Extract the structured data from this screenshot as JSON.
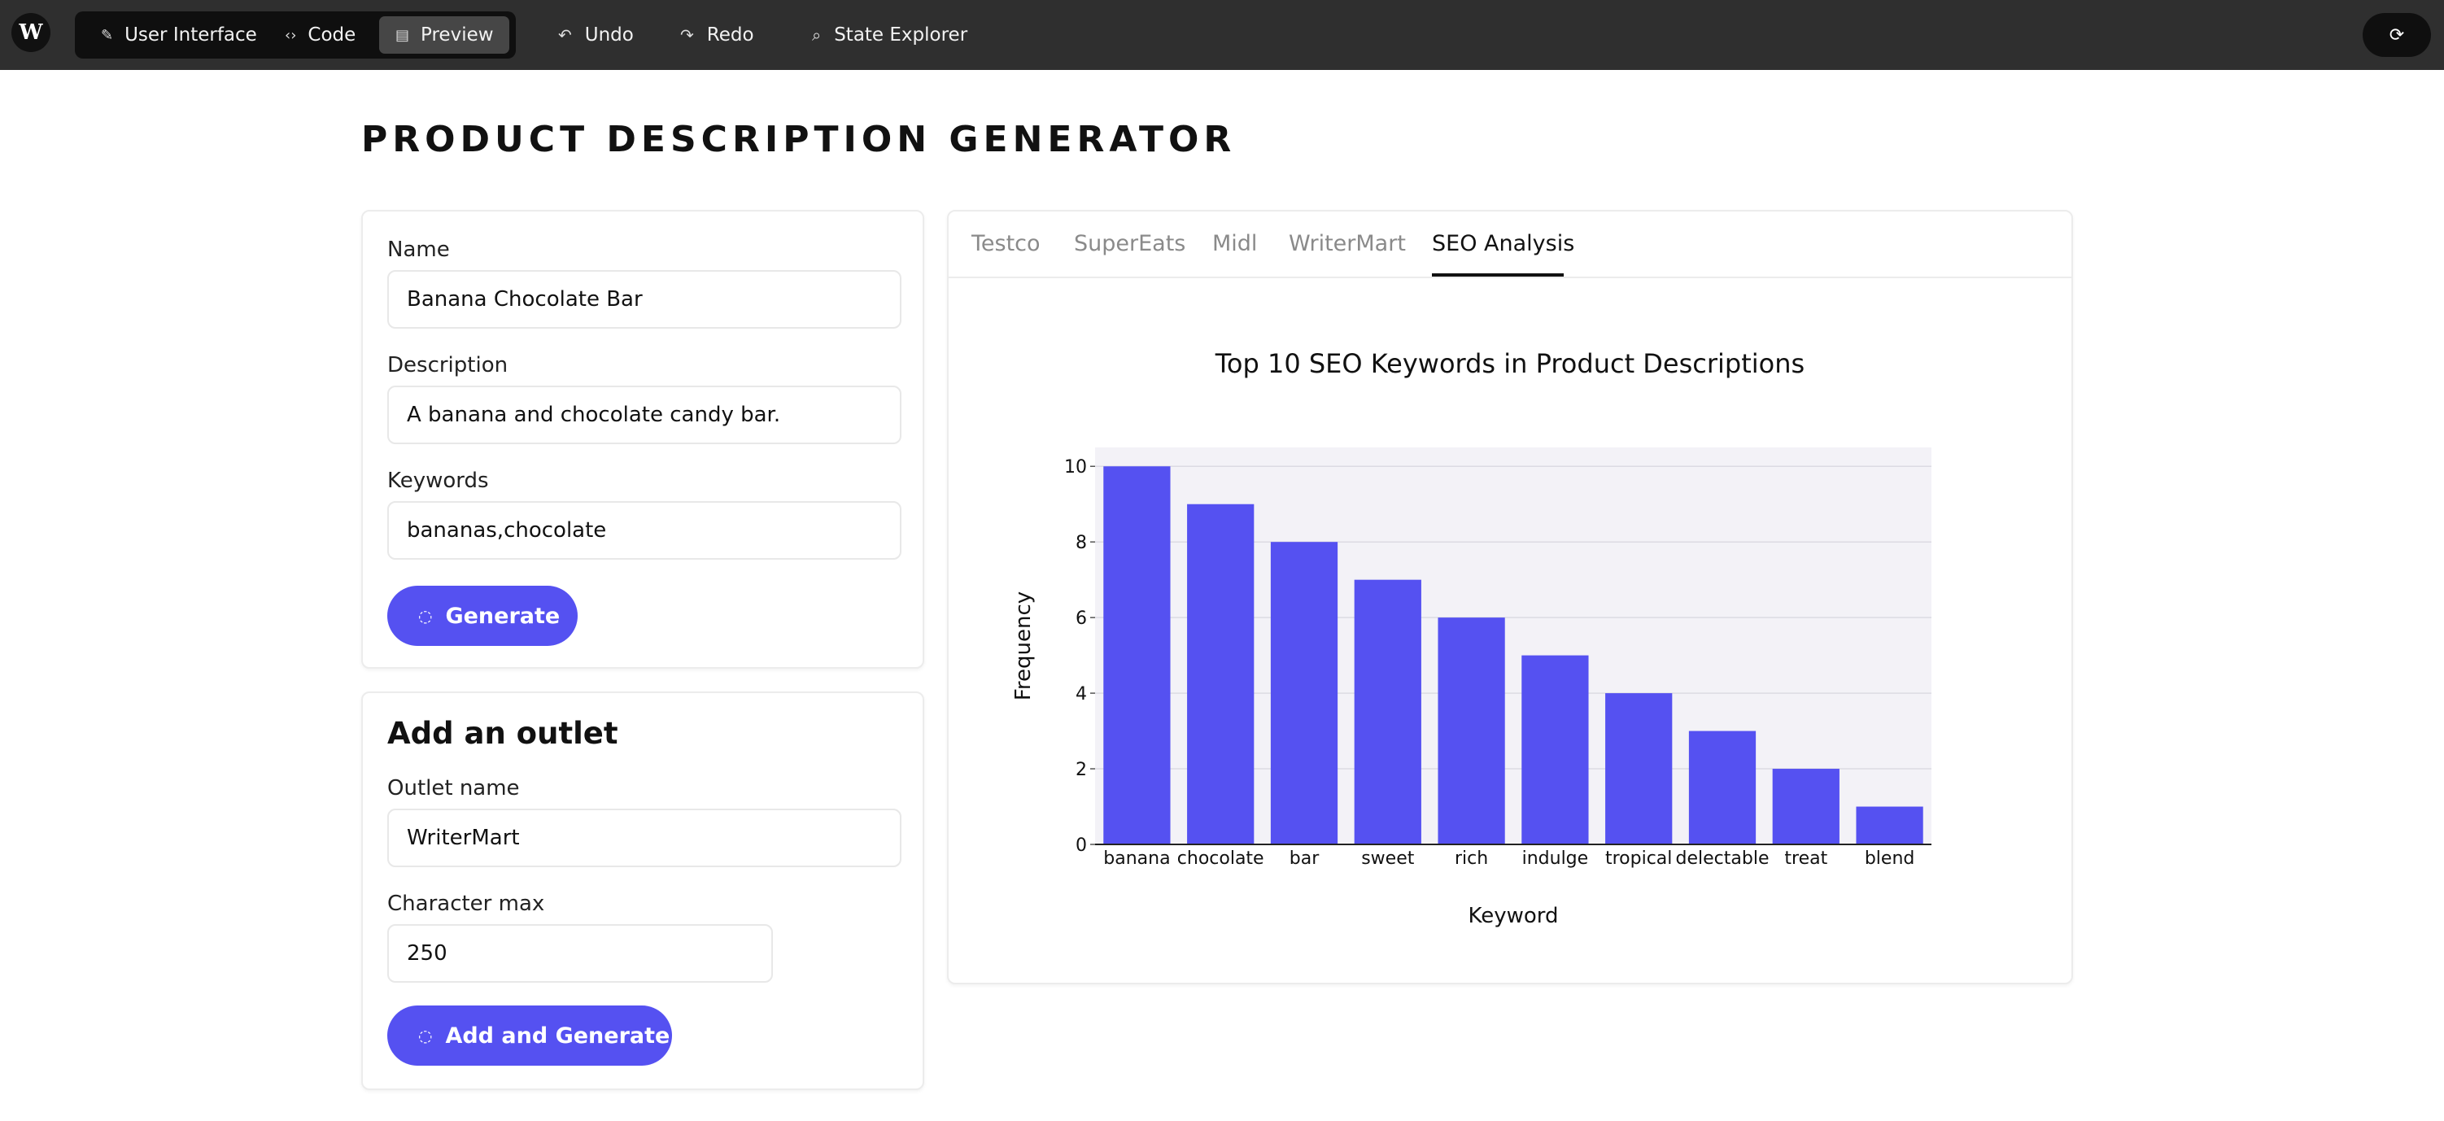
{
  "topbar": {
    "logo_text": "W",
    "modes": [
      {
        "label": "User Interface",
        "icon": "pencil-icon",
        "active": false
      },
      {
        "label": "Code",
        "icon": "code-icon",
        "active": false
      },
      {
        "label": "Preview",
        "icon": "preview-icon",
        "active": true
      }
    ],
    "undo_label": "Undo",
    "redo_label": "Redo",
    "state_explorer_label": "State Explorer",
    "refresh_icon": "refresh-icon"
  },
  "page": {
    "title": "PRODUCT DESCRIPTION GENERATOR"
  },
  "form": {
    "name_label": "Name",
    "name_value": "Banana Chocolate Bar",
    "description_label": "Description",
    "description_value": "A banana and chocolate candy bar.",
    "keywords_label": "Keywords",
    "keywords_value": "bananas,chocolate",
    "generate_label": "Generate"
  },
  "outlet": {
    "title": "Add an outlet",
    "name_label": "Outlet name",
    "name_value": "WriterMart",
    "charmax_label": "Character max",
    "charmax_value": "250",
    "submit_label": "Add and Generate"
  },
  "tabs": [
    {
      "label": "Testco",
      "active": false
    },
    {
      "label": "SuperEats",
      "active": false
    },
    {
      "label": "Midl",
      "active": false
    },
    {
      "label": "WriterMart",
      "active": false
    },
    {
      "label": "SEO Analysis",
      "active": true
    }
  ],
  "colors": {
    "accent": "#5551f1",
    "plot_bg": "#f3f2f7",
    "topbar_bg": "#2f2f2f"
  },
  "chart_data": {
    "type": "bar",
    "title": "Top 10 SEO Keywords in Product Descriptions",
    "xlabel": "Keyword",
    "ylabel": "Frequency",
    "categories": [
      "banana",
      "chocolate",
      "bar",
      "sweet",
      "rich",
      "indulge",
      "tropical",
      "delectable",
      "treat",
      "blend"
    ],
    "values": [
      10,
      9,
      8,
      7,
      6,
      5,
      4,
      3,
      2,
      1
    ],
    "ylim": [
      0,
      10.5
    ],
    "yticks": [
      0,
      2,
      4,
      6,
      8,
      10
    ],
    "grid": true,
    "color": "#5551f1"
  }
}
